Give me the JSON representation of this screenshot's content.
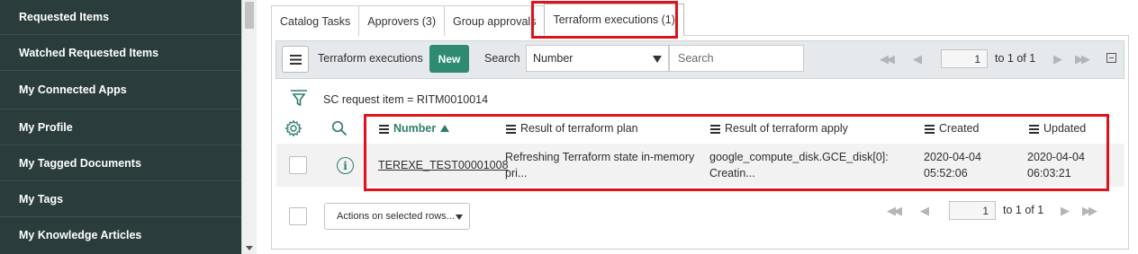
{
  "sidebar": {
    "items": [
      {
        "label": "Requested Items"
      },
      {
        "label": "Watched Requested Items"
      },
      {
        "label": "My Connected Apps"
      },
      {
        "label": "My Profile"
      },
      {
        "label": "My Tagged Documents"
      },
      {
        "label": "My Tags"
      },
      {
        "label": "My Knowledge Articles"
      }
    ]
  },
  "tabs": [
    {
      "label": "Catalog Tasks"
    },
    {
      "label": "Approvers (3)"
    },
    {
      "label": "Group approvals"
    },
    {
      "label": "Terraform executions (1)",
      "active": true
    }
  ],
  "toolbar": {
    "title": "Terraform executions",
    "new_label": "New",
    "search_label": "Search",
    "search_field": "Number",
    "search_placeholder": "Search",
    "page_value": "1",
    "page_text": "to 1 of 1"
  },
  "filter": {
    "text": "SC request item = RITM0010014"
  },
  "table": {
    "columns": [
      {
        "label": "Number",
        "sorted": "ascending"
      },
      {
        "label": "Result of terraform plan"
      },
      {
        "label": "Result of terraform apply"
      },
      {
        "label": "Created"
      },
      {
        "label": "Updated"
      }
    ],
    "rows": [
      {
        "number": "TEREXE_TEST00001008",
        "plan_line1": "Refreshing Terraform state in-memory",
        "plan_line2": "pri...",
        "apply_line1": "google_compute_disk.GCE_disk[0]:",
        "apply_line2": "Creatin...",
        "created_date": "2020-04-04",
        "created_time": "05:52:06",
        "updated_date": "2020-04-04",
        "updated_time": "06:03:21"
      }
    ]
  },
  "footer": {
    "actions_label": "Actions on selected rows...",
    "page_value": "1",
    "page_text": "to 1 of 1"
  },
  "colors": {
    "sidebar_bg": "#2b3d3b",
    "accent_green": "#2e8b72",
    "highlight_red": "#e0111b"
  }
}
